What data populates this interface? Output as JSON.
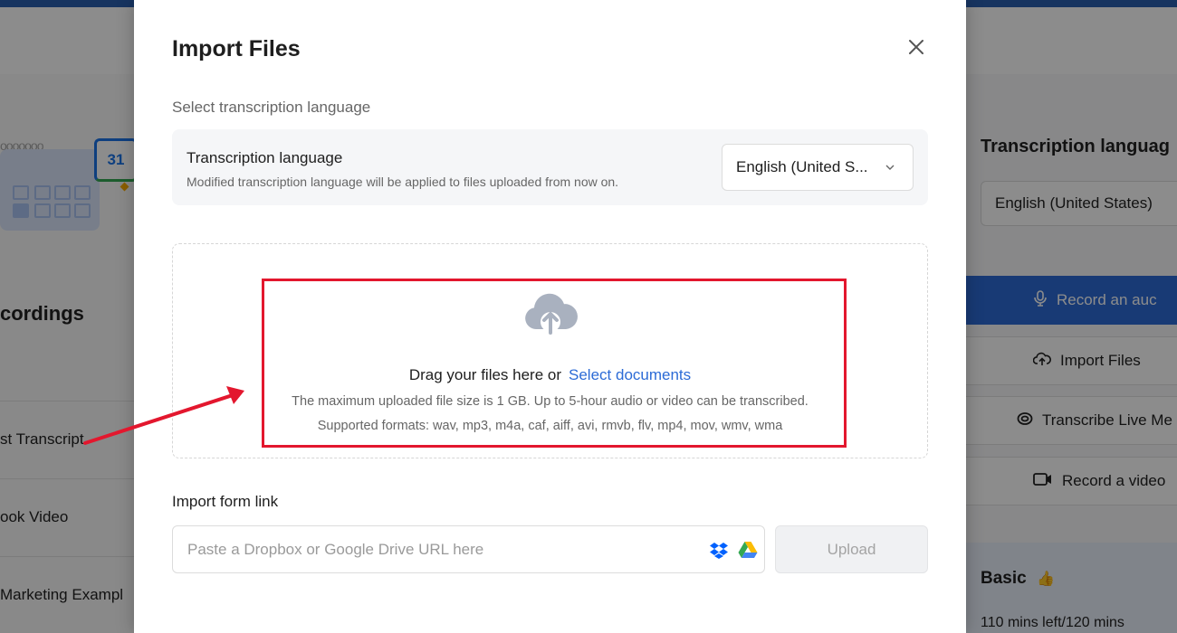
{
  "background": {
    "left_panel": {
      "calendar_day": "31",
      "recordings_heading": "cordings",
      "list_items": [
        "st Transcript",
        "ook Video",
        "Marketing Exampl"
      ]
    },
    "right_panel": {
      "title": "Transcription languag",
      "selected_language": "English (United States)",
      "buttons": [
        {
          "label": "Record an auc",
          "icon": "microphone-icon"
        },
        {
          "label": "Import Files",
          "icon": "cloud-upload-icon"
        },
        {
          "label": "Transcribe Live Me",
          "icon": "live-meeting-icon"
        },
        {
          "label": "Record a video",
          "icon": "video-camera-icon"
        }
      ],
      "plan": {
        "name": "Basic",
        "usage": "110 mins left/120 mins"
      }
    }
  },
  "modal": {
    "title": "Import Files",
    "close_icon": "close-icon",
    "language_section_label": "Select transcription language",
    "language_box": {
      "title": "Transcription language",
      "description": "Modified transcription language will be applied to files uploaded from now on.",
      "selected": "English (United S...",
      "chevron_icon": "chevron-down-icon"
    },
    "dropzone": {
      "icon": "cloud-upload-icon",
      "drag_text": "Drag your files here or",
      "select_link": "Select documents",
      "limit_text": "The maximum uploaded file size is 1 GB. Up to 5-hour audio or video can be transcribed.",
      "formats_text": "Supported formats: wav, mp3, m4a, caf, aiff, avi, rmvb, flv, mp4, mov, wmv, wma"
    },
    "link_import": {
      "label": "Import form link",
      "placeholder": "Paste a Dropbox or Google Drive URL here",
      "value": "",
      "upload_label": "Upload",
      "icons": [
        "dropbox-icon",
        "google-drive-icon"
      ]
    }
  },
  "colors": {
    "accent_blue": "#2c6bd6",
    "annotation_red": "#e3172e",
    "text_primary": "#1e1e1e",
    "text_secondary": "#666666"
  }
}
